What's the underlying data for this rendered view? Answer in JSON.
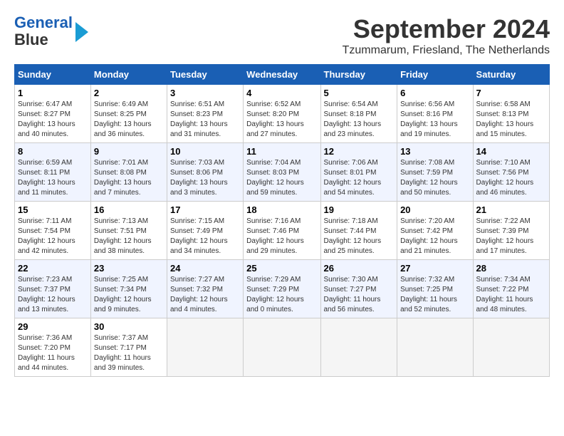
{
  "logo": {
    "line1": "General",
    "line2": "Blue"
  },
  "title": "September 2024",
  "subtitle": "Tzummarum, Friesland, The Netherlands",
  "weekdays": [
    "Sunday",
    "Monday",
    "Tuesday",
    "Wednesday",
    "Thursday",
    "Friday",
    "Saturday"
  ],
  "weeks": [
    [
      {
        "day": "1",
        "sunrise": "6:47 AM",
        "sunset": "8:27 PM",
        "daylight": "13 hours and 40 minutes."
      },
      {
        "day": "2",
        "sunrise": "6:49 AM",
        "sunset": "8:25 PM",
        "daylight": "13 hours and 36 minutes."
      },
      {
        "day": "3",
        "sunrise": "6:51 AM",
        "sunset": "8:23 PM",
        "daylight": "13 hours and 31 minutes."
      },
      {
        "day": "4",
        "sunrise": "6:52 AM",
        "sunset": "8:20 PM",
        "daylight": "13 hours and 27 minutes."
      },
      {
        "day": "5",
        "sunrise": "6:54 AM",
        "sunset": "8:18 PM",
        "daylight": "13 hours and 23 minutes."
      },
      {
        "day": "6",
        "sunrise": "6:56 AM",
        "sunset": "8:16 PM",
        "daylight": "13 hours and 19 minutes."
      },
      {
        "day": "7",
        "sunrise": "6:58 AM",
        "sunset": "8:13 PM",
        "daylight": "13 hours and 15 minutes."
      }
    ],
    [
      {
        "day": "8",
        "sunrise": "6:59 AM",
        "sunset": "8:11 PM",
        "daylight": "13 hours and 11 minutes."
      },
      {
        "day": "9",
        "sunrise": "7:01 AM",
        "sunset": "8:08 PM",
        "daylight": "13 hours and 7 minutes."
      },
      {
        "day": "10",
        "sunrise": "7:03 AM",
        "sunset": "8:06 PM",
        "daylight": "13 hours and 3 minutes."
      },
      {
        "day": "11",
        "sunrise": "7:04 AM",
        "sunset": "8:03 PM",
        "daylight": "12 hours and 59 minutes."
      },
      {
        "day": "12",
        "sunrise": "7:06 AM",
        "sunset": "8:01 PM",
        "daylight": "12 hours and 54 minutes."
      },
      {
        "day": "13",
        "sunrise": "7:08 AM",
        "sunset": "7:59 PM",
        "daylight": "12 hours and 50 minutes."
      },
      {
        "day": "14",
        "sunrise": "7:10 AM",
        "sunset": "7:56 PM",
        "daylight": "12 hours and 46 minutes."
      }
    ],
    [
      {
        "day": "15",
        "sunrise": "7:11 AM",
        "sunset": "7:54 PM",
        "daylight": "12 hours and 42 minutes."
      },
      {
        "day": "16",
        "sunrise": "7:13 AM",
        "sunset": "7:51 PM",
        "daylight": "12 hours and 38 minutes."
      },
      {
        "day": "17",
        "sunrise": "7:15 AM",
        "sunset": "7:49 PM",
        "daylight": "12 hours and 34 minutes."
      },
      {
        "day": "18",
        "sunrise": "7:16 AM",
        "sunset": "7:46 PM",
        "daylight": "12 hours and 29 minutes."
      },
      {
        "day": "19",
        "sunrise": "7:18 AM",
        "sunset": "7:44 PM",
        "daylight": "12 hours and 25 minutes."
      },
      {
        "day": "20",
        "sunrise": "7:20 AM",
        "sunset": "7:42 PM",
        "daylight": "12 hours and 21 minutes."
      },
      {
        "day": "21",
        "sunrise": "7:22 AM",
        "sunset": "7:39 PM",
        "daylight": "12 hours and 17 minutes."
      }
    ],
    [
      {
        "day": "22",
        "sunrise": "7:23 AM",
        "sunset": "7:37 PM",
        "daylight": "12 hours and 13 minutes."
      },
      {
        "day": "23",
        "sunrise": "7:25 AM",
        "sunset": "7:34 PM",
        "daylight": "12 hours and 9 minutes."
      },
      {
        "day": "24",
        "sunrise": "7:27 AM",
        "sunset": "7:32 PM",
        "daylight": "12 hours and 4 minutes."
      },
      {
        "day": "25",
        "sunrise": "7:29 AM",
        "sunset": "7:29 PM",
        "daylight": "12 hours and 0 minutes."
      },
      {
        "day": "26",
        "sunrise": "7:30 AM",
        "sunset": "7:27 PM",
        "daylight": "11 hours and 56 minutes."
      },
      {
        "day": "27",
        "sunrise": "7:32 AM",
        "sunset": "7:25 PM",
        "daylight": "11 hours and 52 minutes."
      },
      {
        "day": "28",
        "sunrise": "7:34 AM",
        "sunset": "7:22 PM",
        "daylight": "11 hours and 48 minutes."
      }
    ],
    [
      {
        "day": "29",
        "sunrise": "7:36 AM",
        "sunset": "7:20 PM",
        "daylight": "11 hours and 44 minutes."
      },
      {
        "day": "30",
        "sunrise": "7:37 AM",
        "sunset": "7:17 PM",
        "daylight": "11 hours and 39 minutes."
      },
      null,
      null,
      null,
      null,
      null
    ]
  ]
}
